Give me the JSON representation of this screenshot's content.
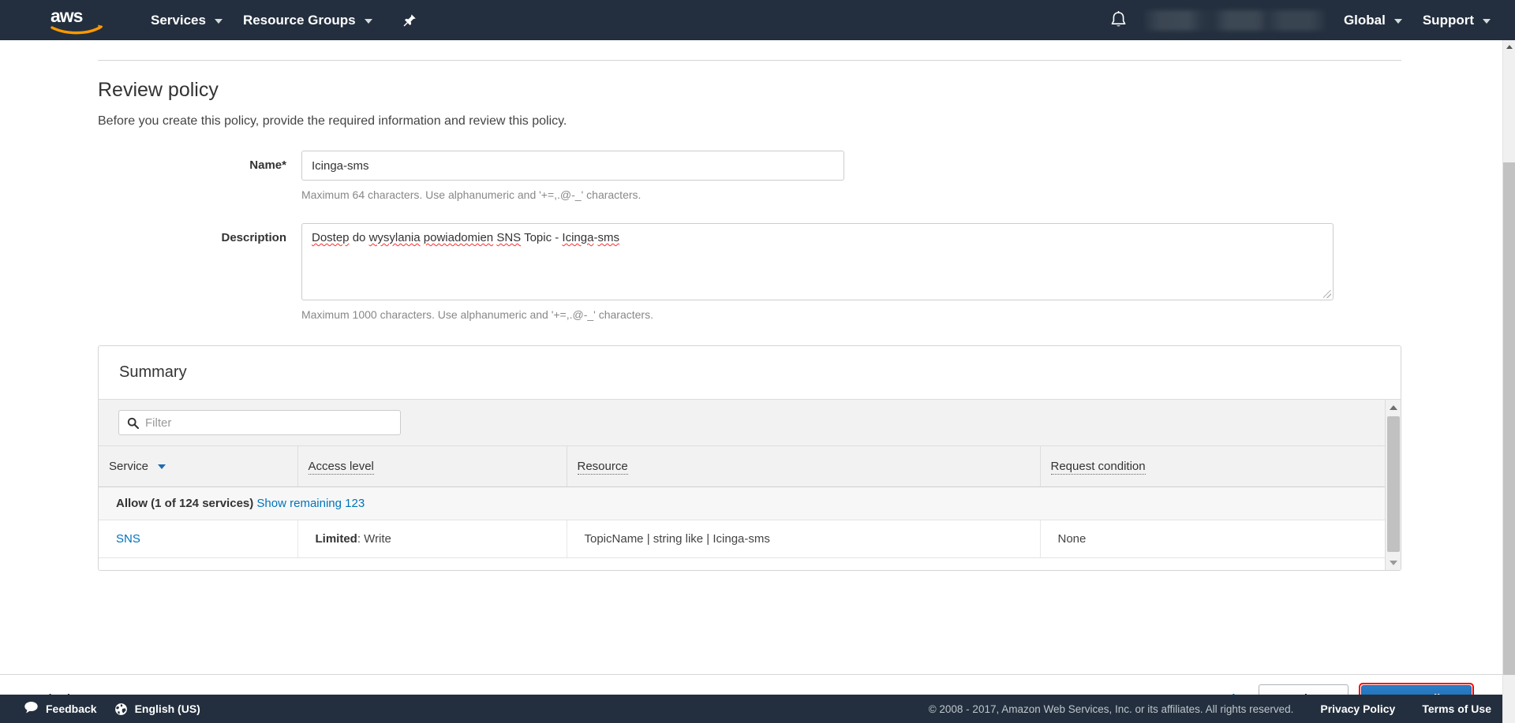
{
  "topnav": {
    "logo_alt": "aws",
    "services_label": "Services",
    "resource_groups_label": "Resource Groups",
    "pin_icon": "pin-icon",
    "bell_icon": "bell-icon",
    "account_label": "",
    "global_label": "Global",
    "support_label": "Support"
  },
  "page": {
    "title": "Review policy",
    "subtitle": "Before you create this policy, provide the required information and review this policy."
  },
  "form": {
    "name_label": "Name*",
    "name_value": "Icinga-sms",
    "name_placeholder": "",
    "name_help": "Maximum 64 characters. Use alphanumeric and '+=,.@-_' characters.",
    "description_label": "Description",
    "description_value": "Dostep do wysylania powiadomien SNS Topic - Icinga-sms",
    "description_parts": {
      "w1": "Dostep",
      "t1": " do ",
      "w2": "wysylania",
      "t2": " ",
      "w3": "powiadomien",
      "t3": " ",
      "w4": "SNS",
      "t4": " Topic - ",
      "w5": "Icinga",
      "t5": "-",
      "w6": "sms"
    },
    "description_help": "Maximum 1000 characters. Use alphanumeric and '+=,.@-_' characters."
  },
  "summary": {
    "heading": "Summary",
    "filter_placeholder": "Filter",
    "search_icon": "search-icon",
    "columns": [
      {
        "label": "Service",
        "sortable": true
      },
      {
        "label": "Access level",
        "sortable": false
      },
      {
        "label": "Resource",
        "sortable": false
      },
      {
        "label": "Request condition",
        "sortable": false
      }
    ],
    "group_row": {
      "label": "Allow (1 of 124 services)",
      "link": "Show remaining 123"
    },
    "rows": [
      {
        "service": "SNS",
        "access_level_strong": "Limited",
        "access_level_rest": ": Write",
        "resource": "TopicName | string like | Icinga-sms",
        "request_condition": "None"
      }
    ]
  },
  "actionbar": {
    "required_note": "* Required",
    "cancel_label": "Cancel",
    "previous_label": "Previous",
    "create_label": "Create policy"
  },
  "footer": {
    "feedback_label": "Feedback",
    "feedback_icon": "speech-bubble-icon",
    "language_label": "English (US)",
    "language_icon": "globe-icon",
    "copyright": "© 2008 - 2017, Amazon Web Services, Inc. or its affiliates. All rights reserved.",
    "privacy_label": "Privacy Policy",
    "terms_label": "Terms of Use"
  },
  "colors": {
    "nav_bg": "#232f3e",
    "link": "#0073bb",
    "primary_button": "#1565a8",
    "highlight_ring": "#ff0000",
    "aws_orange": "#ff9900"
  }
}
